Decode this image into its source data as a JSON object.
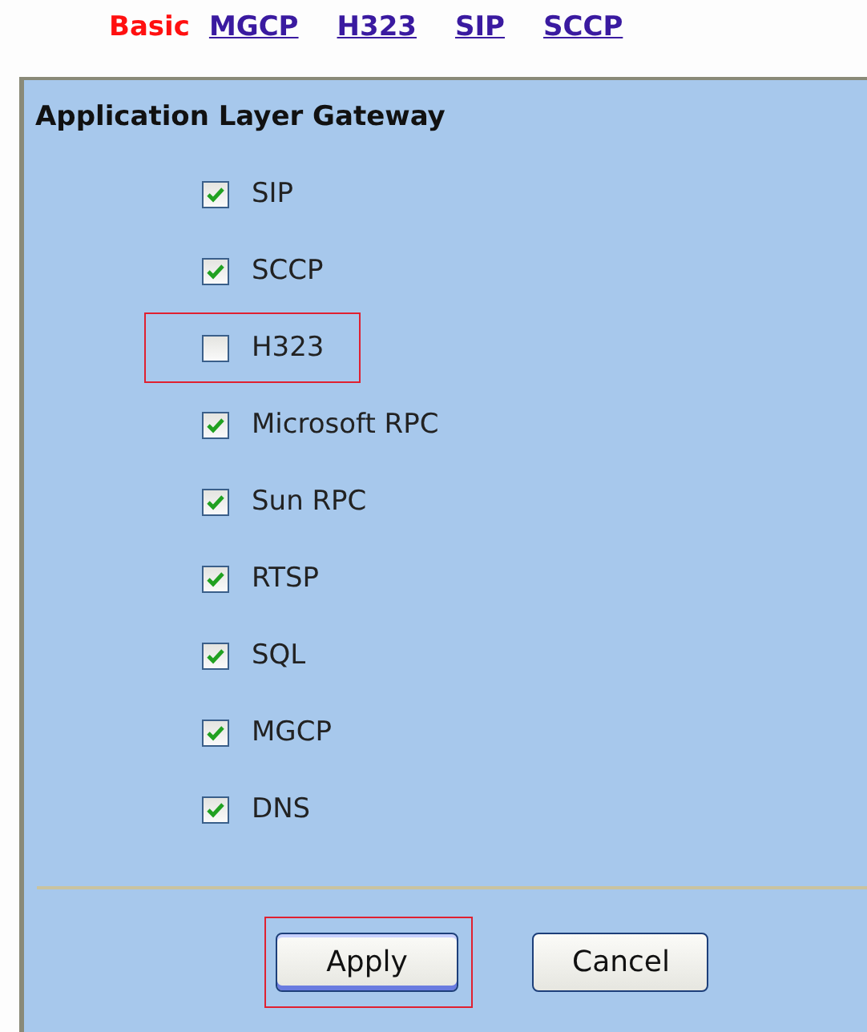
{
  "nav": [
    {
      "label": "Basic",
      "selected": true
    },
    {
      "label": "MGCP",
      "selected": false
    },
    {
      "label": "H323",
      "selected": false
    },
    {
      "label": "SIP",
      "selected": false
    },
    {
      "label": "SCCP",
      "selected": false
    }
  ],
  "panel": {
    "title": "Application Layer Gateway",
    "options": [
      {
        "label": "SIP",
        "checked": true,
        "highlighted": false
      },
      {
        "label": "SCCP",
        "checked": true,
        "highlighted": false
      },
      {
        "label": "H323",
        "checked": false,
        "highlighted": true
      },
      {
        "label": "Microsoft RPC",
        "checked": true,
        "highlighted": false
      },
      {
        "label": "Sun RPC",
        "checked": true,
        "highlighted": false
      },
      {
        "label": "RTSP",
        "checked": true,
        "highlighted": false
      },
      {
        "label": "SQL",
        "checked": true,
        "highlighted": false
      },
      {
        "label": "MGCP",
        "checked": true,
        "highlighted": false
      },
      {
        "label": "DNS",
        "checked": true,
        "highlighted": false
      }
    ],
    "buttons": [
      {
        "label": "Apply",
        "highlighted": true
      },
      {
        "label": "Cancel",
        "highlighted": false
      }
    ]
  }
}
